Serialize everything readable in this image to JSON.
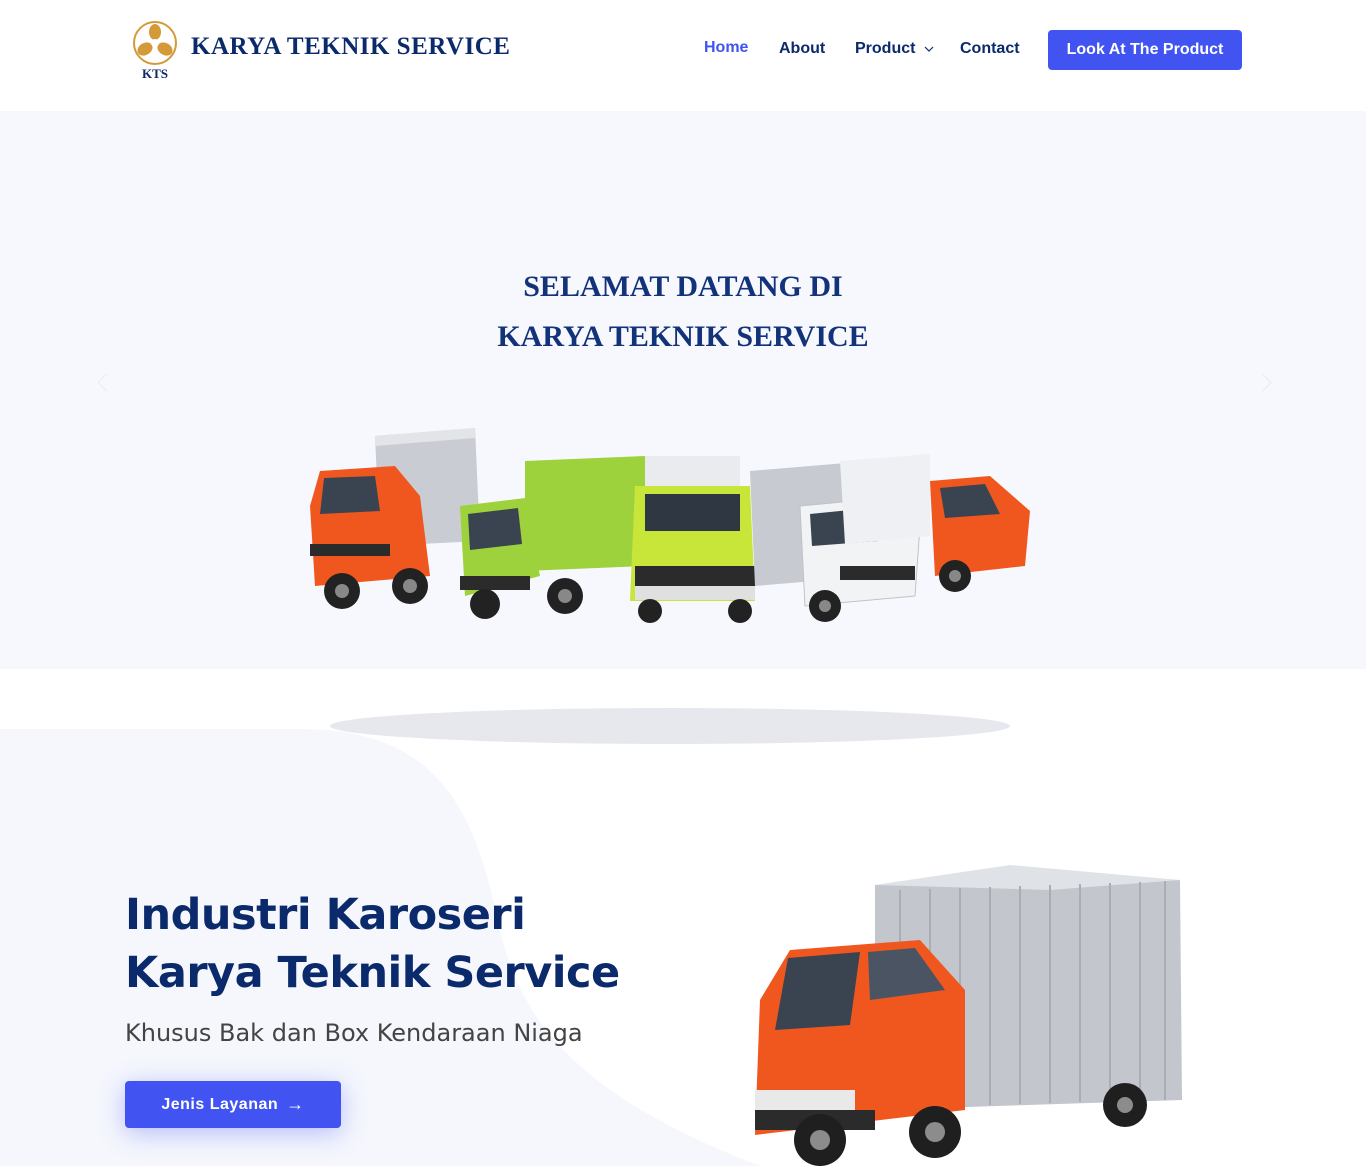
{
  "header": {
    "logo_text": "KTS",
    "brand": "KARYA TEKNIK SERVICE",
    "nav": {
      "home": "Home",
      "about": "About",
      "product": "Product",
      "contact": "Contact"
    },
    "cta": "Look At The Product"
  },
  "hero": {
    "title_line1": "SELAMAT DATANG DI",
    "title_line2": "KARYA TEKNIK SERVICE"
  },
  "section": {
    "title_line1": "Industri Karoseri",
    "title_line2": "Karya Teknik Service",
    "subtitle": "Khusus Bak dan Box Kendaraan Niaga",
    "button": "Jenis Layanan",
    "button_icon": "arrow-right-icon"
  },
  "colors": {
    "accent": "#4154f1",
    "navy": "#0b2a6b",
    "hero_bg": "#f6f8fd",
    "logo_gold": "#d49a3a",
    "truck_orange": "#f0571f",
    "truck_green": "#9ed23c"
  }
}
